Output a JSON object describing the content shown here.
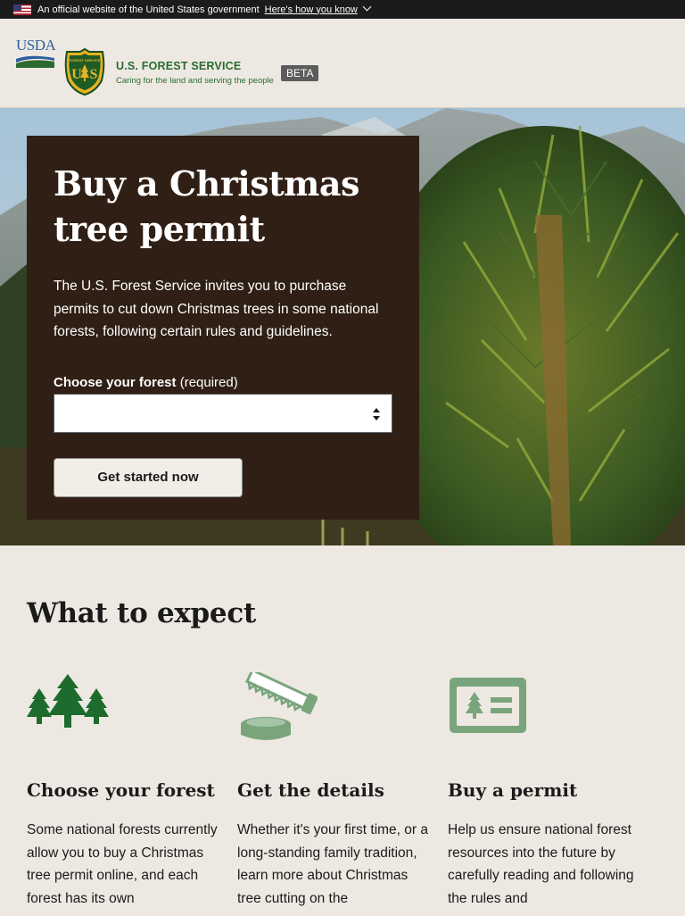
{
  "gov_banner": {
    "text": "An official website of the United States government",
    "link": "Here's how you know"
  },
  "header": {
    "usda_label": "USDA",
    "agency_name": "U.S. FOREST SERVICE",
    "tagline": "Caring for the land and serving the people",
    "badge": "BETA",
    "shield_text": "FOREST SERVICE"
  },
  "hero": {
    "title": "Buy a Christmas tree permit",
    "lead": "The U.S. Forest Service invites you to purchase permits to cut down Christmas trees in some national forests, following certain rules and guidelines.",
    "forest_label": "Choose your forest",
    "forest_required": "(required)",
    "forest_select_value": "",
    "cta": "Get started now"
  },
  "expect": {
    "title": "What to expect",
    "items": [
      {
        "icon": "trees-icon",
        "title": "Choose your forest",
        "text": "Some national forests currently allow you to buy a Christmas tree permit online, and each forest has its own"
      },
      {
        "icon": "saw-stump-icon",
        "title": "Get the details",
        "text": "Whether it's your first time, or a long-standing family tradition, learn more about Christmas tree cutting on the"
      },
      {
        "icon": "permit-card-icon",
        "title": "Buy a permit",
        "text": "Help us ensure national forest resources into the future by carefully reading and following the rules and"
      }
    ]
  },
  "colors": {
    "hero_card": "#2f1f14",
    "brand_green": "#2b6b2f",
    "icon_dark_green": "#1e6b2e",
    "icon_sage": "#7aa57c"
  }
}
